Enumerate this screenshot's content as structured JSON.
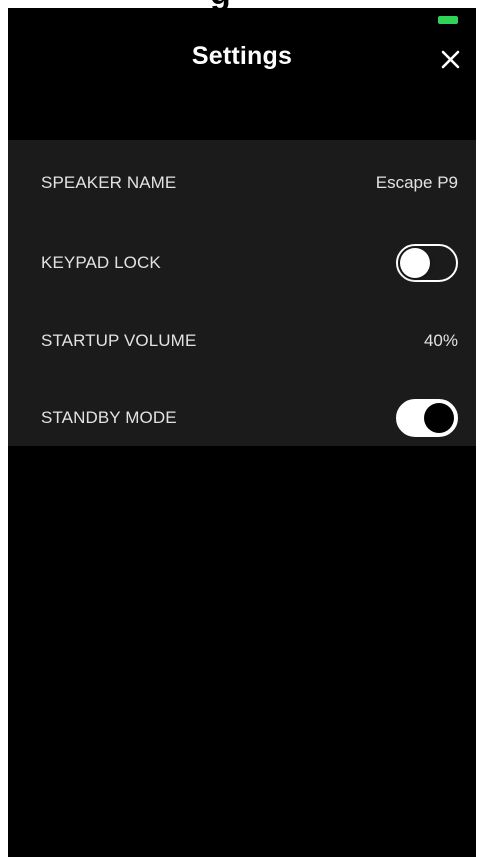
{
  "header": {
    "title": "Settings"
  },
  "status_bar": {
    "battery_color": "#2fd457"
  },
  "settings": {
    "speaker_name": {
      "label": "SPEAKER NAME",
      "value": "Escape P9"
    },
    "keypad_lock": {
      "label": "KEYPAD LOCK",
      "enabled": false
    },
    "startup_volume": {
      "label": "STARTUP VOLUME",
      "value": "40%"
    },
    "standby_mode": {
      "label": "STANDBY MODE",
      "enabled": true
    }
  },
  "colors": {
    "background": "#000000",
    "panel": "#1b1b1b",
    "text": "#e2e2e2"
  }
}
